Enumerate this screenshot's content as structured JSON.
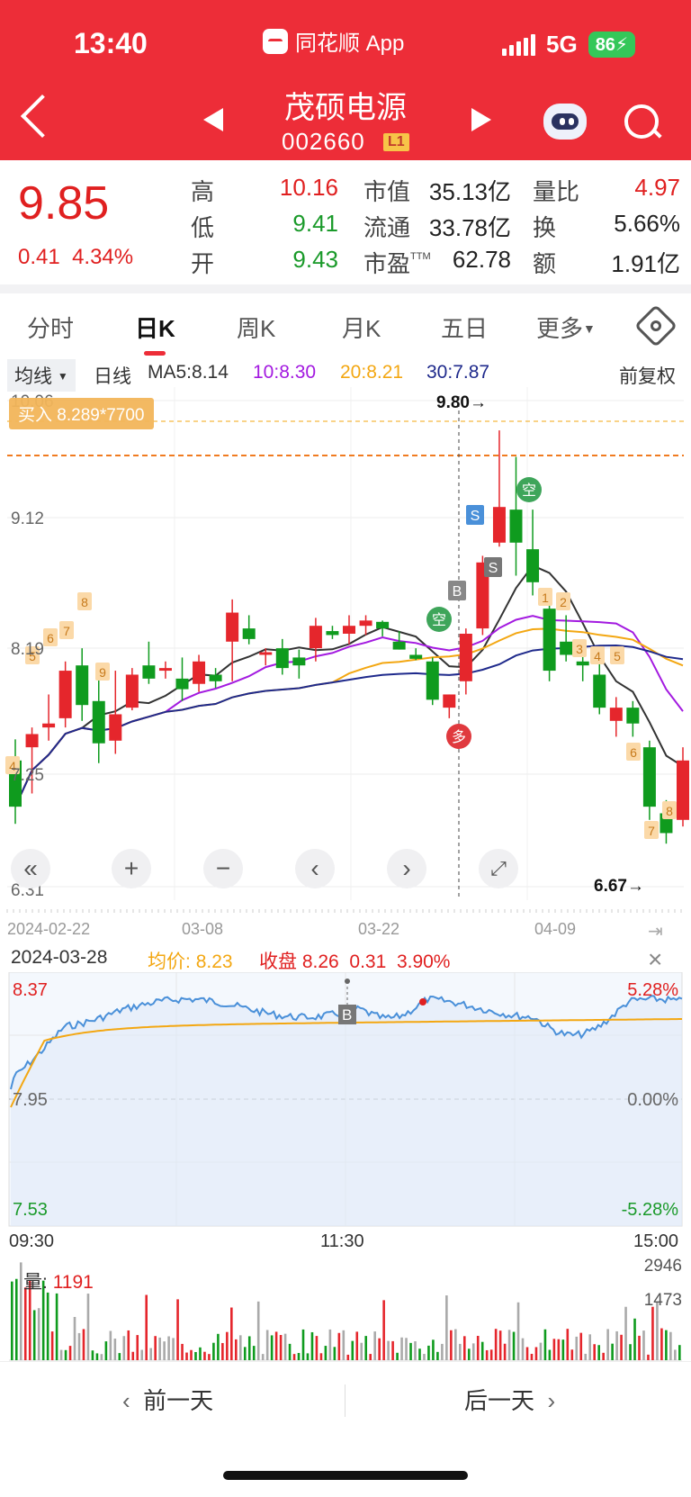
{
  "status_bar": {
    "time": "13:40",
    "app_name": "同花顺 App",
    "network": "5G",
    "battery": "86"
  },
  "header": {
    "stock_name": "茂硕电源",
    "stock_code": "002660",
    "level": "L1",
    "icons": [
      "back-icon",
      "prev-stock-icon",
      "next-stock-icon",
      "assistant-robot-icon",
      "search-icon"
    ]
  },
  "quote": {
    "price": "9.85",
    "change": "0.41",
    "change_pct": "4.34%",
    "high_label": "高",
    "high": "10.16",
    "low_label": "低",
    "low": "9.41",
    "open_label": "开",
    "open": "9.43",
    "mktcap_label": "市值",
    "mktcap": "35.13亿",
    "float_label": "流通",
    "float": "33.78亿",
    "pe_label": "市盈",
    "pe_sup": "TTM",
    "pe": "62.78",
    "volratio_label": "量比",
    "volratio": "4.97",
    "turnover_label": "换",
    "turnover": "5.66%",
    "amount_label": "额",
    "amount": "1.91亿"
  },
  "tabs": [
    {
      "label": "分时"
    },
    {
      "label": "日K"
    },
    {
      "label": "周K"
    },
    {
      "label": "月K"
    },
    {
      "label": "五日"
    },
    {
      "label": "更多"
    }
  ],
  "ma_bar": {
    "selector": "均线",
    "period": "日线",
    "ma5": "MA5:8.14",
    "ma10": "10:8.30",
    "ma20": "20:8.21",
    "ma30": "30:7.87",
    "adjust": "前复权"
  },
  "kline": {
    "buy_badge": "买入 8.289*7700",
    "max_label": "9.80→",
    "min_label": "6.67→",
    "y_labels": [
      "10.06",
      "9.12",
      "8.19",
      "7.25",
      "6.31"
    ],
    "x_labels": [
      "2024-02-22",
      "03-08",
      "03-22",
      "04-09"
    ],
    "marker_kong": "空",
    "marker_duo": "多",
    "marker_s": "S",
    "marker_b": "B",
    "rank_tags": [
      "4",
      "5",
      "6",
      "7",
      "8",
      "9",
      "1",
      "2",
      "3",
      "4",
      "5",
      "6",
      "7",
      "8"
    ]
  },
  "chart_data": {
    "type": "candlestick",
    "categories_hint": "daily, 2024-02-22 to 04-12",
    "ohlc": [
      [
        7.3,
        7.46,
        6.82,
        6.95
      ],
      [
        7.4,
        7.55,
        7.05,
        7.5
      ],
      [
        7.55,
        7.8,
        7.45,
        7.58
      ],
      [
        7.62,
        8.05,
        7.55,
        7.98
      ],
      [
        8.02,
        8.15,
        7.6,
        7.72
      ],
      [
        7.75,
        8.02,
        7.28,
        7.43
      ],
      [
        7.45,
        7.98,
        7.35,
        7.65
      ],
      [
        7.7,
        8.0,
        7.68,
        7.95
      ],
      [
        8.02,
        8.2,
        7.88,
        7.92
      ],
      [
        7.98,
        8.05,
        7.92,
        8.0
      ],
      [
        7.92,
        8.08,
        7.75,
        7.84
      ],
      [
        7.88,
        8.1,
        7.82,
        8.05
      ],
      [
        7.95,
        8.0,
        7.85,
        7.9
      ],
      [
        8.2,
        8.52,
        7.9,
        8.42
      ],
      [
        8.3,
        8.4,
        8.18,
        8.22
      ],
      [
        8.1,
        8.15,
        8.02,
        8.12
      ],
      [
        8.15,
        8.22,
        7.95,
        8.0
      ],
      [
        8.08,
        8.14,
        7.92,
        8.02
      ],
      [
        8.15,
        8.38,
        8.05,
        8.32
      ],
      [
        8.28,
        8.32,
        8.22,
        8.25
      ],
      [
        8.26,
        8.4,
        8.18,
        8.32
      ],
      [
        8.32,
        8.4,
        8.25,
        8.36
      ],
      [
        8.35,
        8.36,
        8.24,
        8.3
      ],
      [
        8.2,
        8.28,
        8.14,
        8.14
      ],
      [
        8.1,
        8.15,
        8.06,
        8.07
      ],
      [
        8.05,
        8.08,
        7.72,
        7.76
      ],
      [
        7.7,
        7.8,
        7.62,
        7.8
      ],
      [
        7.9,
        8.3,
        7.8,
        8.26
      ],
      [
        8.3,
        8.85,
        8.25,
        8.8
      ],
      [
        8.95,
        9.8,
        8.92,
        9.22
      ],
      [
        9.2,
        9.6,
        8.7,
        8.95
      ],
      [
        8.9,
        9.2,
        8.55,
        8.65
      ],
      [
        8.45,
        8.55,
        7.9,
        7.98
      ],
      [
        8.2,
        8.4,
        8.05,
        8.1
      ],
      [
        8.05,
        8.2,
        7.9,
        8.02
      ],
      [
        7.95,
        8.05,
        7.65,
        7.7
      ],
      [
        7.6,
        7.78,
        7.48,
        7.7
      ],
      [
        7.7,
        7.75,
        7.48,
        7.58
      ],
      [
        7.4,
        7.45,
        6.85,
        6.95
      ],
      [
        6.9,
        7.0,
        6.67,
        6.75
      ],
      [
        6.85,
        7.4,
        6.8,
        7.3
      ]
    ],
    "ma_series": [
      {
        "name": "MA5",
        "color": "#333333"
      },
      {
        "name": "10",
        "color": "#a31ae0"
      },
      {
        "name": "20",
        "color": "#f3a712"
      },
      {
        "name": "30",
        "color": "#1f2a8c"
      }
    ]
  },
  "intraday": {
    "date": "2024-03-28",
    "avg_label": "均价:",
    "avg": "8.23",
    "close_label": "收盘",
    "close": "8.26",
    "chg": "0.31",
    "pct": "3.90%",
    "top_price": "8.37",
    "mid_price": "7.95",
    "bot_price": "7.53",
    "top_pct": "5.28%",
    "mid_pct": "0.00%",
    "bot_pct": "-5.28%",
    "times": [
      "09:30",
      "11:30",
      "15:00"
    ],
    "marker_b": "B"
  },
  "volume": {
    "label": "量:",
    "value": "1191",
    "max": "2946",
    "half": "1473"
  },
  "footer": {
    "prev": "前一天",
    "next": "后一天"
  }
}
